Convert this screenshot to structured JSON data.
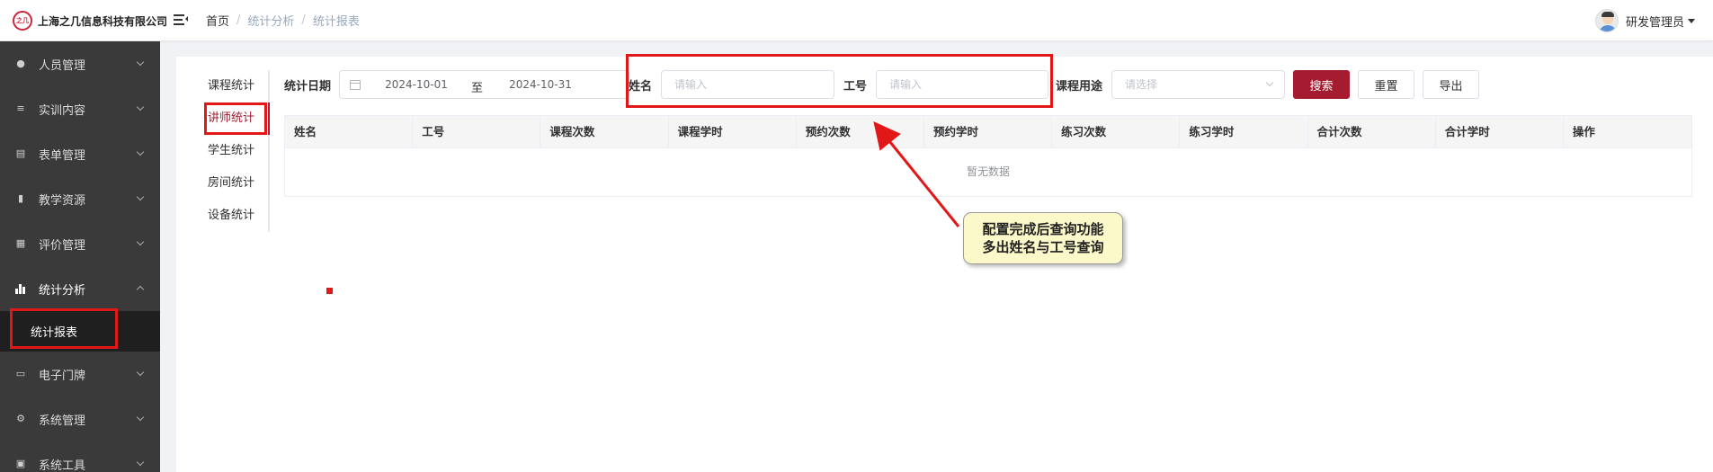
{
  "header": {
    "company": "上海之几信息科技有限公司",
    "logo_text": "之几",
    "breadcrumb": [
      "首页",
      "统计分析",
      "统计报表"
    ],
    "user_name": "研发管理员"
  },
  "sidebar": {
    "items": [
      {
        "label": "人员管理",
        "icon": "user-icon"
      },
      {
        "label": "实训内容",
        "icon": "list-icon"
      },
      {
        "label": "表单管理",
        "icon": "form-icon"
      },
      {
        "label": "教学资源",
        "icon": "book-icon"
      },
      {
        "label": "评价管理",
        "icon": "evaluate-icon"
      },
      {
        "label": "统计分析",
        "icon": "bar-chart-icon",
        "expanded": true
      },
      {
        "label": "电子门牌",
        "icon": "monitor-icon"
      },
      {
        "label": "系统管理",
        "icon": "gear-icon"
      },
      {
        "label": "系统工具",
        "icon": "toolbox-icon"
      }
    ],
    "sub_active": "统计报表"
  },
  "tabs": [
    "课程统计",
    "讲师统计",
    "学生统计",
    "房间统计",
    "设备统计"
  ],
  "active_tab": "讲师统计",
  "filters": {
    "date_label": "统计日期",
    "date_start": "2024-10-01",
    "date_sep": "至",
    "date_end": "2024-10-31",
    "name_label": "姓名",
    "name_placeholder": "请输入",
    "id_label": "工号",
    "id_placeholder": "请输入",
    "purpose_label": "课程用途",
    "purpose_placeholder": "请选择"
  },
  "buttons": {
    "search": "搜索",
    "reset": "重置",
    "export": "导出"
  },
  "table": {
    "columns": [
      "姓名",
      "工号",
      "课程次数",
      "课程学时",
      "预约次数",
      "预约学时",
      "练习次数",
      "练习学时",
      "合计次数",
      "合计学时",
      "操作"
    ],
    "empty_text": "暂无数据"
  },
  "annotation": {
    "line1": "配置完成后查询功能",
    "line2": "多出姓名与工号查询",
    "color": "#e21818"
  },
  "colors": {
    "primary": "#a51c30",
    "sidebar_bg": "#3a3a3a"
  }
}
